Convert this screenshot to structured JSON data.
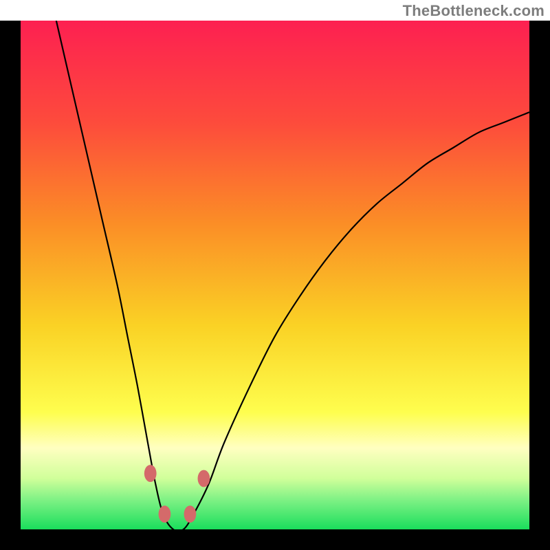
{
  "watermark": "TheBottleneck.com",
  "chart_data": {
    "type": "line",
    "title": "",
    "xlabel": "",
    "ylabel": "",
    "xlim": [
      0,
      100
    ],
    "ylim": [
      0,
      100
    ],
    "grid": false,
    "legend": false,
    "series": [
      {
        "name": "bottleneck-curve",
        "color": "#000000",
        "x": [
          7,
          10,
          13,
          16,
          19,
          21,
          23,
          25,
          26.5,
          28,
          30,
          32,
          34,
          37,
          40,
          45,
          50,
          55,
          60,
          65,
          70,
          75,
          80,
          85,
          90,
          95,
          100
        ],
        "y": [
          100,
          87,
          74,
          61,
          48,
          38,
          28,
          17,
          9,
          3,
          0,
          0,
          3,
          9,
          17,
          28,
          38,
          46,
          53,
          59,
          64,
          68,
          72,
          75,
          78,
          80,
          82
        ]
      }
    ],
    "markers": [
      {
        "name": "left-upper",
        "x": 25.5,
        "y": 11,
        "color": "#d46a6a",
        "r": 1.6
      },
      {
        "name": "left-lower",
        "x": 28.3,
        "y": 3,
        "color": "#d46a6a",
        "r": 1.6
      },
      {
        "name": "right-lower",
        "x": 33.3,
        "y": 3,
        "color": "#d46a6a",
        "r": 1.6
      },
      {
        "name": "right-upper",
        "x": 36.0,
        "y": 10,
        "color": "#d46a6a",
        "r": 1.6
      }
    ],
    "background_gradient": {
      "stops": [
        {
          "offset": 0.0,
          "color": "#fd2051"
        },
        {
          "offset": 0.2,
          "color": "#fd4b3c"
        },
        {
          "offset": 0.4,
          "color": "#fb8e26"
        },
        {
          "offset": 0.6,
          "color": "#fad225"
        },
        {
          "offset": 0.77,
          "color": "#fefe4e"
        },
        {
          "offset": 0.84,
          "color": "#ffffc1"
        },
        {
          "offset": 0.9,
          "color": "#d0ff9a"
        },
        {
          "offset": 0.94,
          "color": "#82f286"
        },
        {
          "offset": 1.0,
          "color": "#1ade5c"
        }
      ]
    }
  }
}
